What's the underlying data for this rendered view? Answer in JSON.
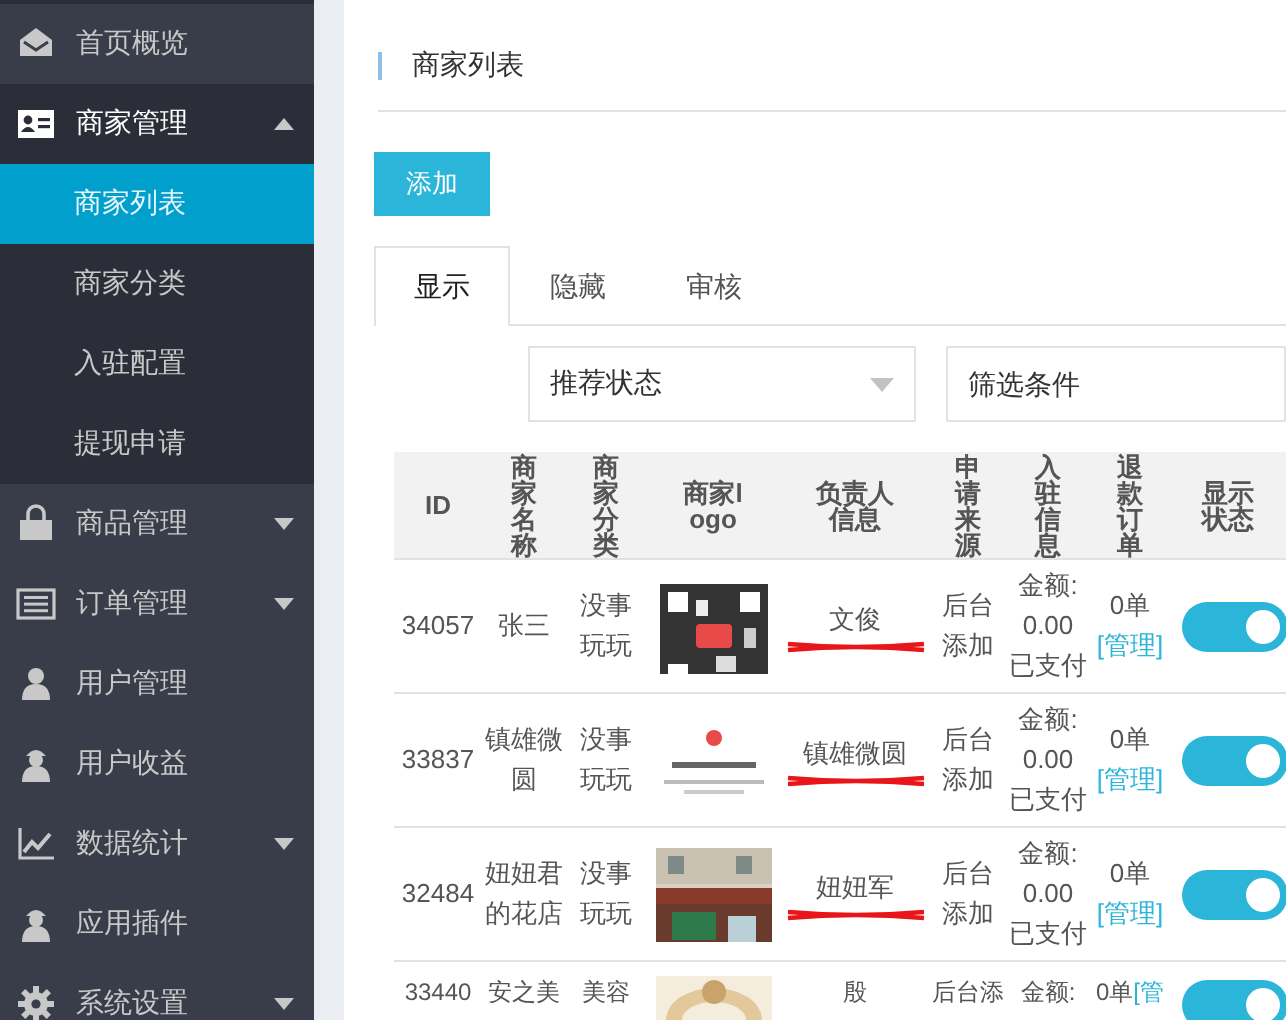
{
  "sidebar": {
    "items": [
      {
        "label": "首页概览",
        "kind": "link"
      },
      {
        "label": "商家管理",
        "kind": "group",
        "expanded": true,
        "children": [
          {
            "label": "商家列表",
            "selected": true
          },
          {
            "label": "商家分类",
            "selected": false
          },
          {
            "label": "入驻配置",
            "selected": false
          },
          {
            "label": "提现申请",
            "selected": false
          }
        ]
      },
      {
        "label": "商品管理",
        "kind": "group",
        "expanded": false
      },
      {
        "label": "订单管理",
        "kind": "group",
        "expanded": false
      },
      {
        "label": "用户管理",
        "kind": "link"
      },
      {
        "label": "用户收益",
        "kind": "link"
      },
      {
        "label": "数据统计",
        "kind": "group",
        "expanded": false
      },
      {
        "label": "应用插件",
        "kind": "link"
      },
      {
        "label": "系统设置",
        "kind": "group",
        "expanded": false
      }
    ]
  },
  "page": {
    "title": "商家列表",
    "add_button": "添加",
    "tabs": [
      {
        "label": "显示",
        "selected": true
      },
      {
        "label": "隐藏",
        "selected": false
      },
      {
        "label": "审核",
        "selected": false
      }
    ],
    "filters": [
      {
        "kind": "select",
        "value": "推荐状态"
      },
      {
        "kind": "input",
        "placeholder": "筛选条件"
      }
    ]
  },
  "table": {
    "columns": [
      "ID",
      "商家名称",
      "商家分类",
      "商家logo",
      "负责人信息",
      "申请来源",
      "入驻信息",
      "退款订单",
      "显示状态"
    ],
    "rows": [
      {
        "id": "34057",
        "name": "张三",
        "category": "没事玩玩",
        "contact": "文俊",
        "phone_redacted": true,
        "source": "后台添加",
        "amount_label": "金额:",
        "amount": "0.00",
        "paid": "已支付",
        "orders": "0单",
        "manage": "[管理]",
        "shown": true
      },
      {
        "id": "33837",
        "name": "镇雄微圆",
        "category": "没事玩玩",
        "contact": "镇雄微圆",
        "phone_redacted": true,
        "source": "后台添加",
        "amount_label": "金额:",
        "amount": "0.00",
        "paid": "已支付",
        "orders": "0单",
        "manage": "[管理]",
        "shown": true
      },
      {
        "id": "32484",
        "name": "妞妞君的花店",
        "category": "没事玩玩",
        "contact": "妞妞军",
        "phone_redacted": true,
        "source": "后台添加",
        "amount_label": "金额:",
        "amount": "0.00",
        "paid": "已支付",
        "orders": "0单",
        "manage": "[管理]",
        "shown": true
      },
      {
        "id": "33440",
        "name": "安之美",
        "category": "美容",
        "contact": "殷",
        "source": "后台添",
        "amount_label": "金额:",
        "orders": "0单",
        "manage": "[管",
        "shown": true
      }
    ]
  }
}
